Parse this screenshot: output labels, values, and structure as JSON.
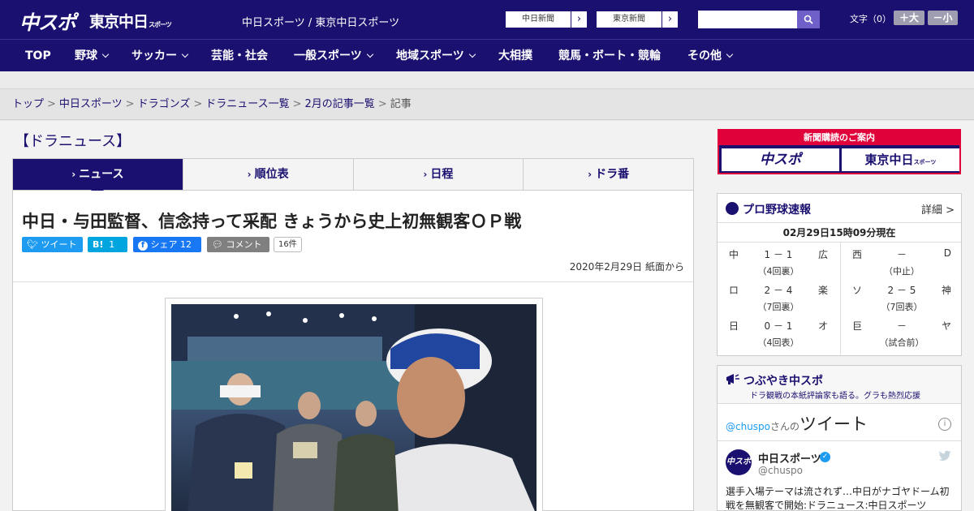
{
  "header": {
    "logo_chuspo": "中スポ",
    "logo_tokyo": "東京中日",
    "logo_tokyo_small": "スポーツ",
    "site_title": "中日スポーツ / 東京中日スポーツ",
    "btn_chunichi": "中日新聞",
    "btn_tokyo": "東京新聞",
    "search_placeholder": "",
    "font_size_label": "文字（0）",
    "font_plus": "＋大",
    "font_minus": "－小"
  },
  "nav": {
    "items": [
      {
        "label": "TOP",
        "dropdown": false
      },
      {
        "label": "野球",
        "dropdown": true
      },
      {
        "label": "サッカー",
        "dropdown": true
      },
      {
        "label": "芸能・社会",
        "dropdown": false
      },
      {
        "label": "一般スポーツ",
        "dropdown": true
      },
      {
        "label": "地域スポーツ",
        "dropdown": true
      },
      {
        "label": "大相撲",
        "dropdown": false
      },
      {
        "label": "競馬・ボート・競輪",
        "dropdown": false
      },
      {
        "label": "その他",
        "dropdown": true
      }
    ]
  },
  "breadcrumb": {
    "items": [
      "トップ",
      "中日スポーツ",
      "ドラゴンズ",
      "ドラニュース一覧",
      "2月の記事一覧"
    ],
    "current": "記事",
    "separator": ">"
  },
  "section_title": "【ドラニュース】",
  "tabs": [
    {
      "label": "ニュース",
      "active": true
    },
    {
      "label": "順位表",
      "active": false
    },
    {
      "label": "日程",
      "active": false
    },
    {
      "label": "ドラ番",
      "active": false
    }
  ],
  "article": {
    "headline": "中日・与田監督、信念持って采配 きょうから史上初無観客ＯＰ戦",
    "share": {
      "tweet": "ツイート",
      "hatena_icon": "B!",
      "hatena_count": "1",
      "facebook": "シェア",
      "facebook_count": "12",
      "comment": "コメント",
      "comment_count": "16件"
    },
    "dateline": "2020年2月29日 紙面から"
  },
  "sidebar": {
    "ad_title": "新聞購読のご案内",
    "ad_logo1": "中スポ",
    "ad_logo2": "東京中日",
    "ad_logo2_small": "スポーツ",
    "scores": {
      "title": "プロ野球速報",
      "detail": "詳細 >",
      "time": "02月29日15時09分現在",
      "games": [
        {
          "home": "中",
          "score": "1 － 1",
          "away": "広",
          "status": "（4回裏）"
        },
        {
          "home": "西",
          "score": "－",
          "away": "D",
          "status": "（中止）"
        },
        {
          "home": "ロ",
          "score": "2 － 4",
          "away": "楽",
          "status": "（7回裏）"
        },
        {
          "home": "ソ",
          "score": "2 － 5",
          "away": "神",
          "status": "（7回表）"
        },
        {
          "home": "日",
          "score": "0 － 1",
          "away": "オ",
          "status": "（4回表）"
        },
        {
          "home": "巨",
          "score": "－",
          "away": "ヤ",
          "status": "（試合前）"
        }
      ]
    },
    "tweets": {
      "title": "つぶやき中スポ",
      "subtitle": "ドラ観戦の本紙評論家も語る。グラも熱烈応援",
      "handle_link": "@chuspo",
      "handle_suffix": "さんの",
      "label_big": "ツイート",
      "info": "i",
      "avatar_text": "中スポ",
      "name": "中日スポーツ",
      "handle": "@chuspo",
      "text": "選手入場テーマは流されず…中日がナゴヤドーム初戦を無観客で開始:ドラニュース:中日スポーツ"
    }
  }
}
